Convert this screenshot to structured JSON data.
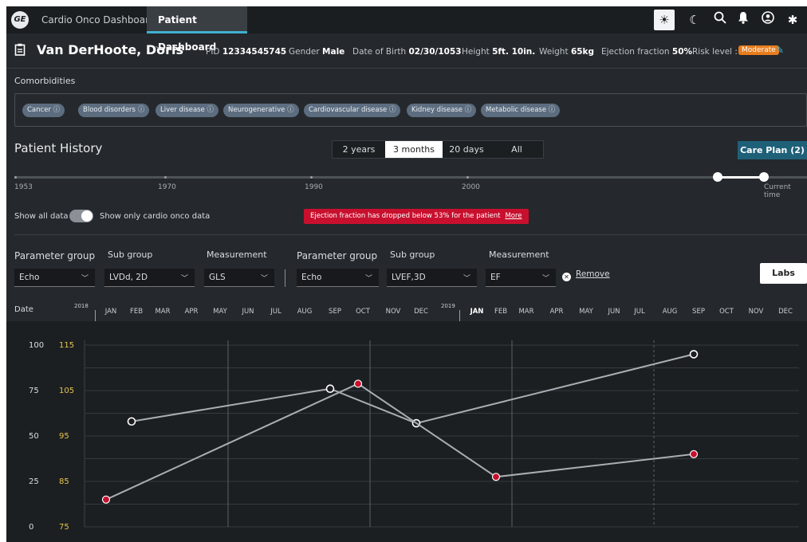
{
  "topbar": {
    "logo": "GE",
    "tabs": [
      {
        "label": "Cardio Onco Dashboard"
      },
      {
        "label": "Patient Dashboard"
      }
    ],
    "icons": [
      "sun-icon",
      "moon-icon",
      "search-icon",
      "bell-icon",
      "user-icon",
      "gear-icon"
    ]
  },
  "patient": {
    "name": "Van DerHoote, Doris",
    "pid_label": "PID",
    "pid": "12334545745",
    "gender_label": "Gender",
    "gender": "Male",
    "dob_label": "Date of Birth",
    "dob": "02/30/1053",
    "height_label": "Height",
    "height": "5ft. 10in.",
    "weight_label": "Weight",
    "weight": "65kg",
    "ef_label": "Ejection fraction",
    "ef": "50%",
    "risk_label": "Risk level :",
    "risk": "Moderate"
  },
  "comorbidities": {
    "title": "Comorbidities",
    "chips": [
      {
        "label": "Cancer"
      },
      {
        "label": "Blood disorders"
      },
      {
        "label": "Liver disease"
      },
      {
        "label": "Neurogenerative"
      },
      {
        "label": "Cardiovascular disease"
      },
      {
        "label": "Kidney disease"
      },
      {
        "label": "Metabolic disease"
      }
    ],
    "info_glyph": "ⓘ"
  },
  "history": {
    "title": "Patient History",
    "ranges": [
      {
        "label": "2 years"
      },
      {
        "label": "3 months"
      },
      {
        "label": "20 days"
      },
      {
        "label": "All"
      }
    ],
    "active_range": "3 months",
    "care_plan": "Care Plan (2)",
    "timeline_labels": [
      "1953",
      "1970",
      "1990",
      "2000",
      "Current time"
    ],
    "show_all": "Show all data",
    "show_cardio": "Show only cardio onco data",
    "alert": "Ejection fraction has dropped below 53% for the patient",
    "alert_more": "More"
  },
  "params": {
    "param_group_label": "Parameter group",
    "sub_group_label": "Sub group",
    "measurement_label": "Measurement",
    "left": {
      "group": "Echo",
      "sub": "LVDd, 2D",
      "measure": "GLS"
    },
    "right": {
      "group": "Echo",
      "sub": "LVEF,3D",
      "measure": "EF"
    },
    "remove": "Remove",
    "labs": "Labs"
  },
  "axis": {
    "date_label": "Date",
    "years": [
      "2018",
      "2019"
    ],
    "months_2018": [
      "JAN",
      "FEB",
      "MAR",
      "APR",
      "MAY",
      "JUN",
      "JUL",
      "AUG",
      "SEP",
      "OCT",
      "NOV",
      "DEC"
    ],
    "months_2019": [
      "JAN",
      "FEB",
      "MAR",
      "APR",
      "MAY",
      "JUN",
      "JUL",
      "AUG",
      "SEP",
      "OCT",
      "NOV",
      "DEC"
    ]
  },
  "chart_data": {
    "type": "line",
    "y_left_ticks": [
      "100",
      "75",
      "50",
      "25",
      "0"
    ],
    "y_right_ticks": [
      "115",
      "105",
      "95",
      "85",
      "75"
    ],
    "ylim_left": [
      0,
      100
    ],
    "ylim_right": [
      75,
      115
    ],
    "grid": true,
    "series": [
      {
        "color": "#ffffff",
        "marker_fill": "#1c1f22",
        "axis": "left",
        "values": [
          {
            "x": "2018-02",
            "y": 58
          },
          {
            "x": "2018-09",
            "y": 76
          },
          {
            "x": "2018-12",
            "y": 57
          },
          {
            "x": "2019-09",
            "y": 95
          }
        ]
      },
      {
        "color": "#c8102e",
        "marker_fill": "#c8102e",
        "axis": "right",
        "values": [
          {
            "x": "2018-01",
            "y": 81
          },
          {
            "x": "2018-10",
            "y": 106.5
          },
          {
            "x": "2019-02",
            "y": 86
          },
          {
            "x": "2019-09",
            "y": 91
          }
        ]
      }
    ]
  }
}
